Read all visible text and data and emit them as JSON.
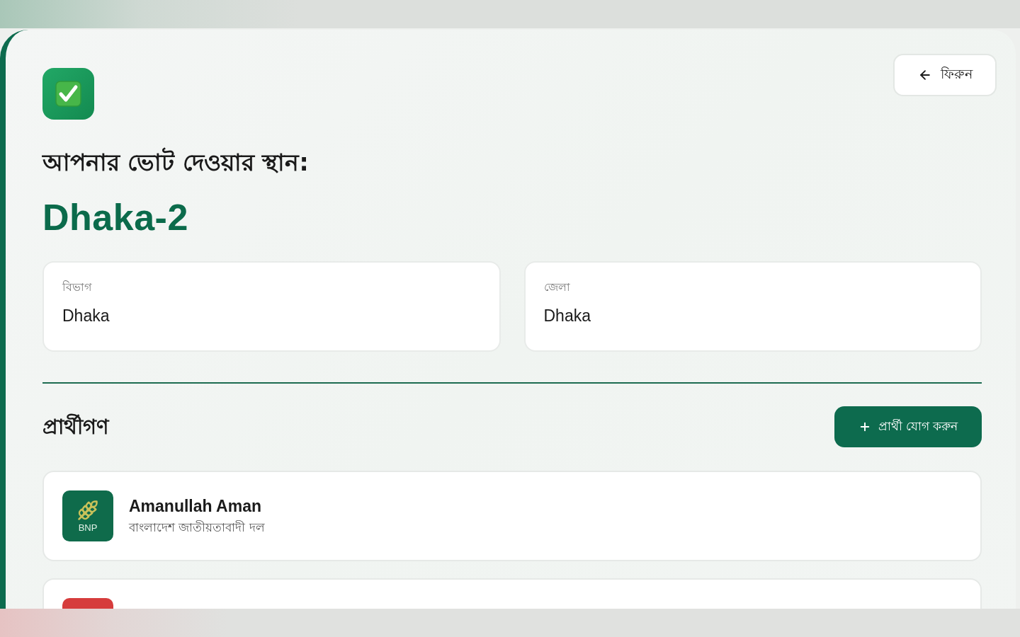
{
  "back_button": {
    "label": "ফিরুন"
  },
  "header": {
    "title": "আপনার ভোট দেওয়ার স্থান:",
    "constituency": "Dhaka-2"
  },
  "info_cards": [
    {
      "label": "বিভাগ",
      "value": "Dhaka"
    },
    {
      "label": "জেলা",
      "value": "Dhaka"
    }
  ],
  "candidates_section": {
    "title": "প্রার্থীগণ",
    "add_button": {
      "label": "প্রার্থী যোগ করুন"
    }
  },
  "candidates": [
    {
      "name": "Amanullah Aman",
      "party": "বাংলাদেশ জাতীয়তাবাদী দল",
      "logo_label": "BNP",
      "color": "#0f6b4b"
    },
    {
      "color": "#d63c3c"
    }
  ]
}
